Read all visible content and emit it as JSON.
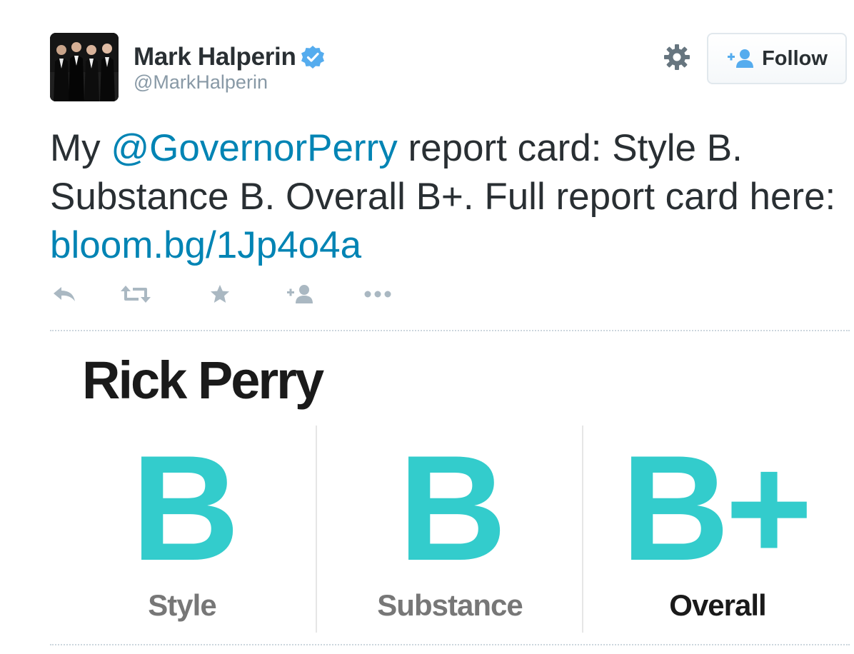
{
  "user": {
    "display_name": "Mark Halperin",
    "handle": "@MarkHalperin",
    "verified_icon": "verified-badge-icon",
    "avatar_icon": "profile-photo"
  },
  "follow_button": {
    "label": "Follow",
    "icon": "add-user-icon"
  },
  "settings_icon": "gear-icon",
  "tweet": {
    "part1": "My ",
    "mention": "@GovernorPerry",
    "part2": " report card: Style B. Substance B. Overall B+. Full report card here: ",
    "link": "bloom.bg/1Jp4o4a"
  },
  "actions": [
    {
      "name": "reply",
      "icon": "reply-icon"
    },
    {
      "name": "retweet",
      "icon": "retweet-icon"
    },
    {
      "name": "favorite",
      "icon": "star-icon"
    },
    {
      "name": "follow",
      "icon": "add-user-icon"
    },
    {
      "name": "more",
      "icon": "more-dots-icon"
    }
  ],
  "card": {
    "title": "Rick Perry",
    "grades": [
      {
        "label": "Style",
        "grade": "B",
        "label_color": "#777777"
      },
      {
        "label": "Substance",
        "grade": "B",
        "label_color": "#777777"
      },
      {
        "label": "Overall",
        "grade": "B+",
        "label_color": "#1a1a1a"
      }
    ]
  },
  "colors": {
    "link": "#0084b4",
    "grade": "#33cccc",
    "verified": "#55acee",
    "action_icon": "#aab8c2",
    "text": "#292f33",
    "handle": "#8899a6"
  }
}
